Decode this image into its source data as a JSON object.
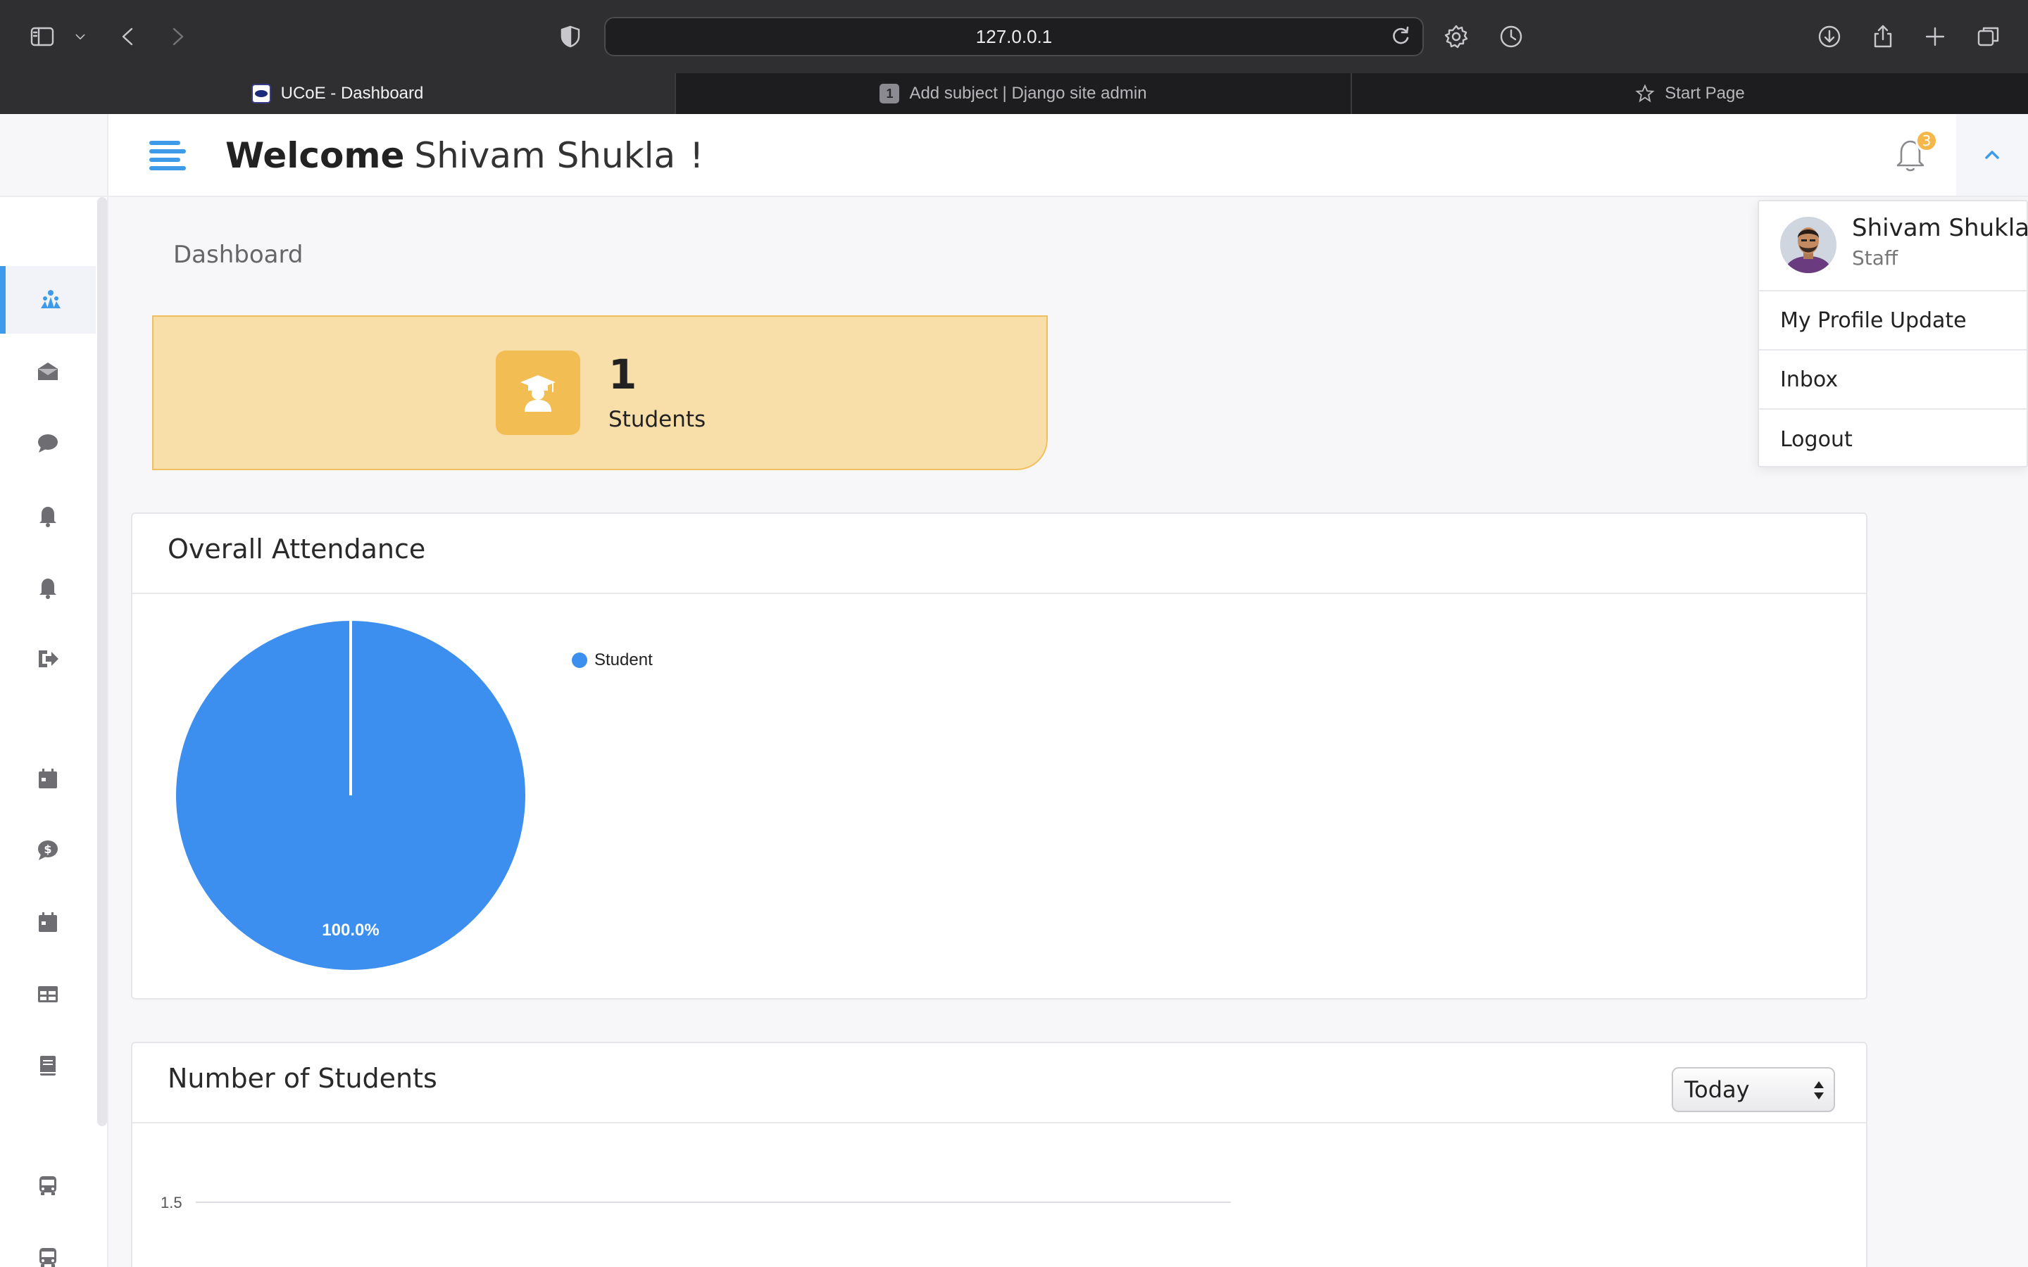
{
  "browser": {
    "address": "127.0.0.1",
    "tabs": [
      {
        "title": "UCoE - Dashboard",
        "favicon": "ucoe-logo"
      },
      {
        "title": "Add subject | Django site admin",
        "favicon_text": "1"
      },
      {
        "title": "Start Page",
        "favicon": "star-icon"
      }
    ],
    "icons": [
      "sidebar-icon",
      "chevron-down-icon",
      "back-icon",
      "forward-icon",
      "shield-icon",
      "reload-icon",
      "gear-icon",
      "history-icon",
      "download-icon",
      "share-icon",
      "plus-icon",
      "tabs-overview-icon"
    ]
  },
  "header": {
    "welcome_bold": "Welcome",
    "user_name": "Shivam Shukla",
    "exclaim": "!",
    "notification_count": "3",
    "accent_color": "#3d9bea"
  },
  "sidebar": {
    "icons": [
      "dashboard-icon",
      "envelope-icon",
      "chat-icon",
      "bell-icon",
      "bell-icon",
      "logout-icon",
      "calendar-icon",
      "dollar-chat-icon",
      "calendar-icon",
      "table-icon",
      "book-icon",
      "bus-icon",
      "bus-icon"
    ],
    "active_index": 0
  },
  "page": {
    "breadcrumb": "Dashboard"
  },
  "stat": {
    "value": "1",
    "label": "Students",
    "icon": "graduate-icon",
    "bg_color": "#f8dea8",
    "icon_color": "#f2bd52"
  },
  "attendance": {
    "title": "Overall Attendance"
  },
  "students_panel": {
    "title": "Number of Students",
    "period": "Today"
  },
  "chart_data": [
    {
      "type": "pie",
      "title": "Overall Attendance",
      "labels": [
        "Student"
      ],
      "values": [
        100
      ],
      "data_labels": [
        "100.0%"
      ],
      "colors": [
        "#3d8fef"
      ],
      "legend": "right"
    },
    {
      "type": "line",
      "title": "Number of Students",
      "y_ticks": [
        "1.5"
      ],
      "grid": true
    }
  ],
  "user_menu": {
    "name": "Shivam Shukla",
    "role": "Staff",
    "items": [
      "My Profile Update",
      "Inbox",
      "Logout"
    ]
  }
}
